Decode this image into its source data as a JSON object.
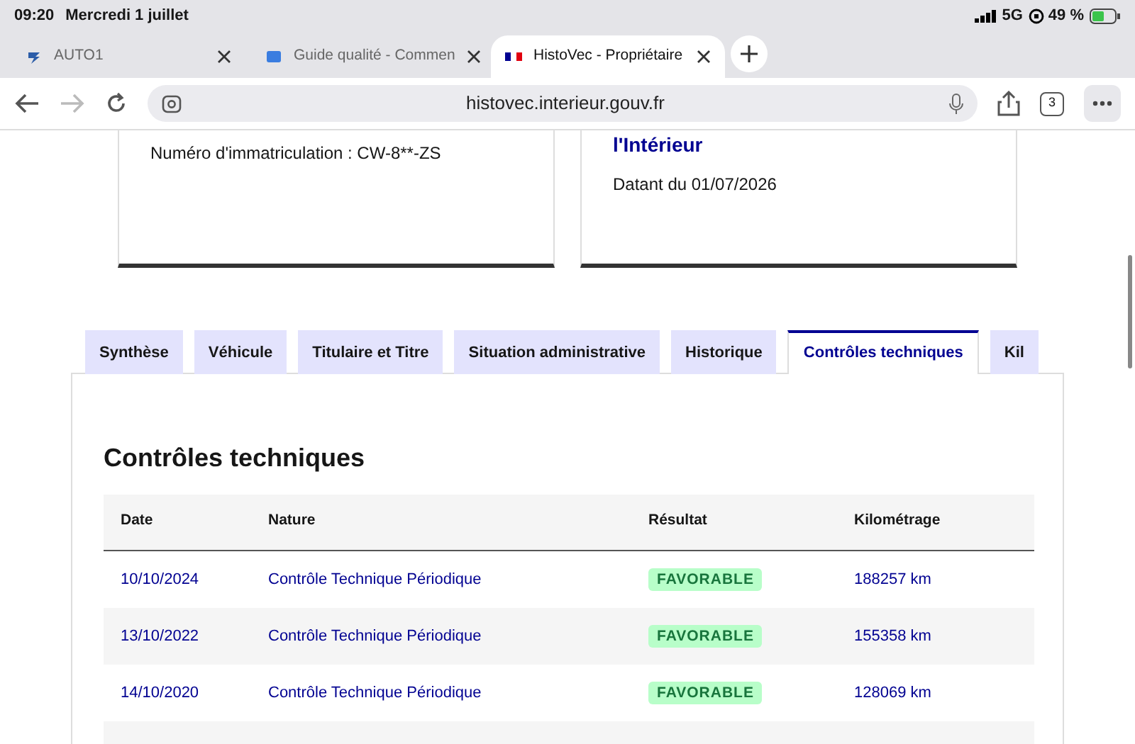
{
  "status_bar": {
    "time": "09:20",
    "date": "Mercredi 1 juillet",
    "network": "5G",
    "battery": "49 %"
  },
  "browser_tabs": [
    {
      "title": "AUTO1",
      "selected": false
    },
    {
      "title": "Guide qualité - Commen",
      "selected": false
    },
    {
      "title": "HistoVec - Propriétaire",
      "selected": true
    }
  ],
  "address_bar": {
    "url": "histovec.interieur.gouv.fr",
    "tab_count": "3"
  },
  "cards": [
    {
      "kind": "vehicle",
      "text": "Numéro d'immatriculation : CW-8**-ZS"
    },
    {
      "kind": "source",
      "title": "l'Intérieur",
      "text": "Datant du 01/07/2026"
    }
  ],
  "tabs": [
    {
      "label": "Synthèse",
      "selected": false
    },
    {
      "label": "Véhicule",
      "selected": false
    },
    {
      "label": "Titulaire et Titre",
      "selected": false
    },
    {
      "label": "Situation administrative",
      "selected": false
    },
    {
      "label": "Historique",
      "selected": false
    },
    {
      "label": "Contrôles techniques",
      "selected": true
    },
    {
      "label": "Kil",
      "selected": false
    }
  ],
  "section_title": "Contrôles techniques",
  "table": {
    "columns": [
      "Date",
      "Nature",
      "Résultat",
      "Kilométrage"
    ],
    "rows": [
      [
        "10/10/2024",
        "Contrôle Technique Périodique",
        "FAVORABLE",
        "188257 km"
      ],
      [
        "13/10/2022",
        "Contrôle Technique Périodique",
        "FAVORABLE",
        "155358 km"
      ],
      [
        "14/10/2020",
        "Contrôle Technique Périodique",
        "FAVORABLE",
        "128069 km"
      ]
    ]
  }
}
